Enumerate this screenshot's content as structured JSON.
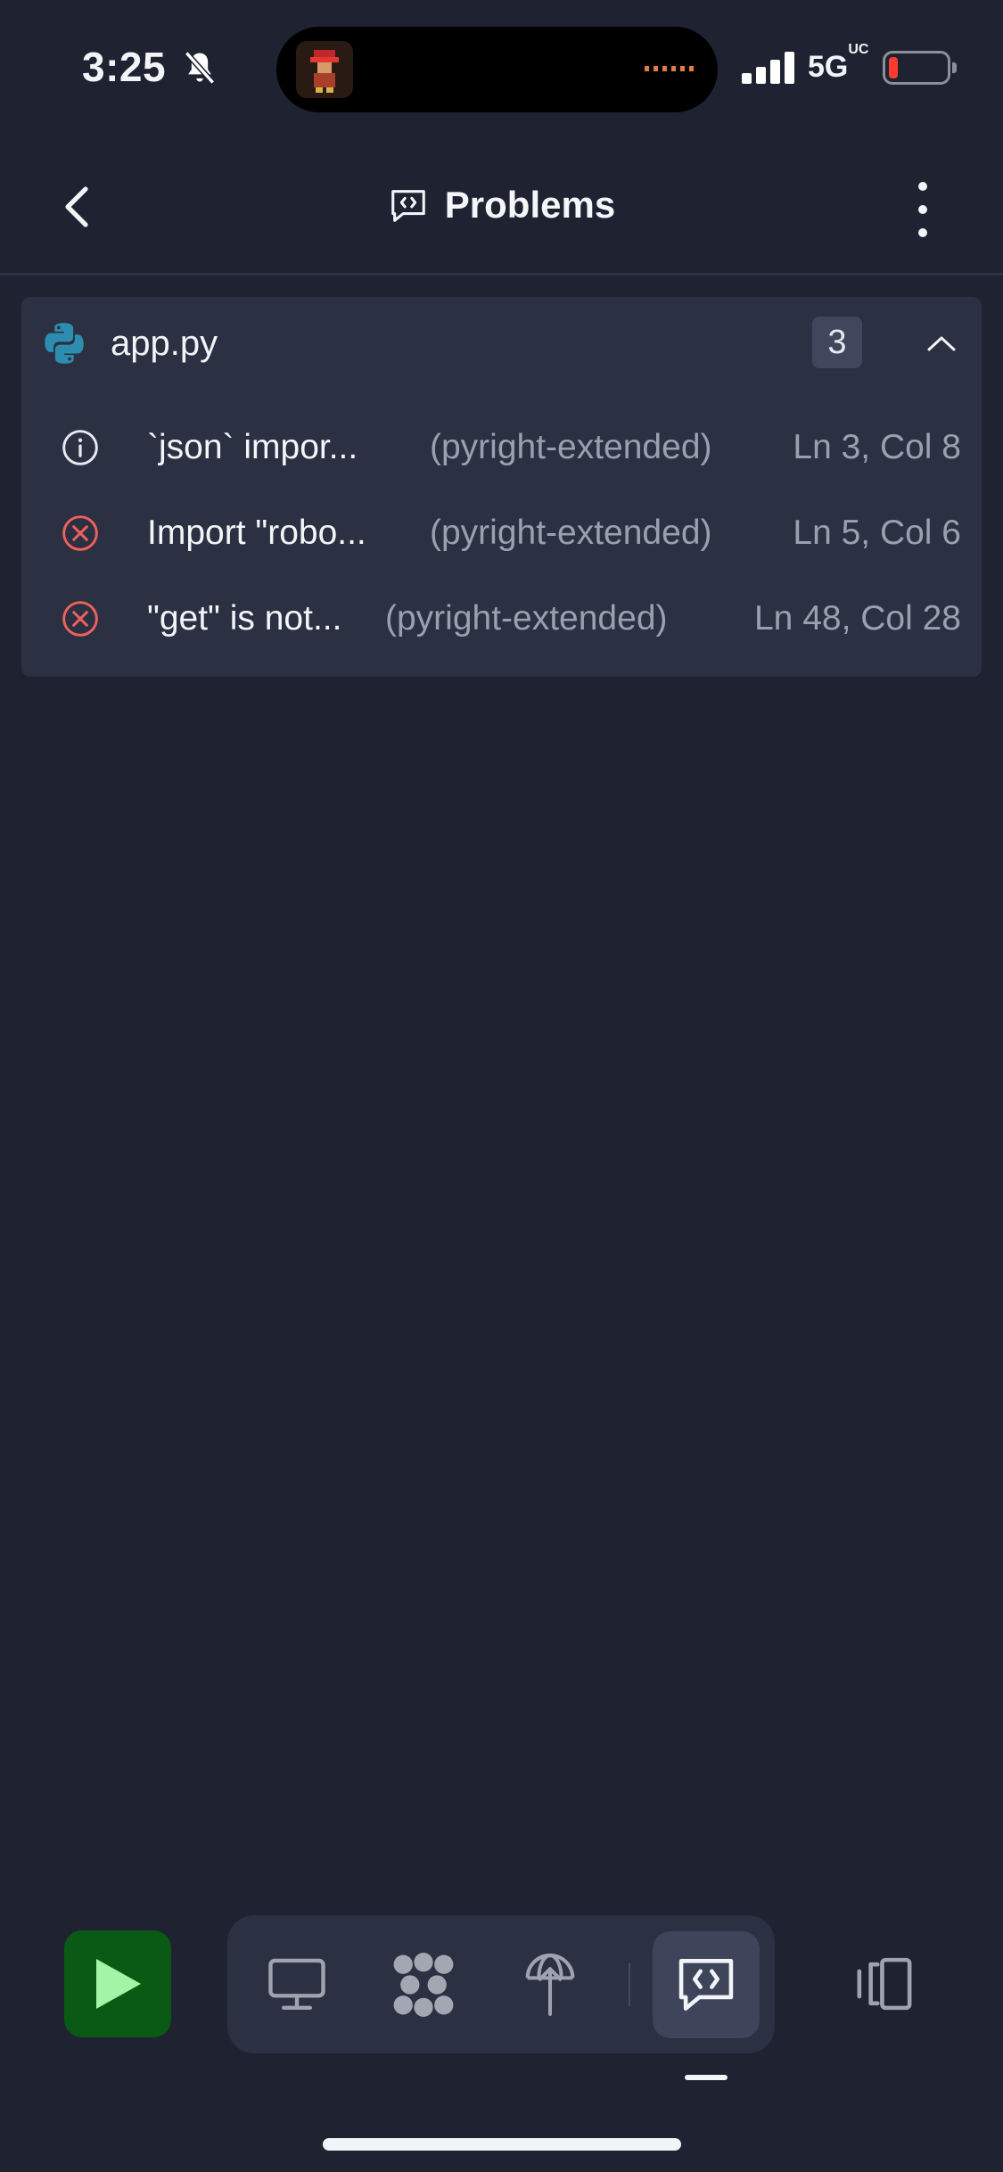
{
  "status_bar": {
    "time": "3:25",
    "network": "5G",
    "network_superscript": "UC",
    "battery_color": "#ff3b30"
  },
  "header": {
    "title": "Problems",
    "title_icon": "code-message-icon"
  },
  "file": {
    "name": "app.py",
    "icon": "python-icon",
    "problem_count": "3",
    "problems": [
      {
        "severity": "info",
        "icon": "info-icon",
        "message": "`json` impor...",
        "source": "(pyright-extended)",
        "location": "Ln 3, Col 8"
      },
      {
        "severity": "error",
        "icon": "error-icon",
        "message": "Import \"robo...",
        "source": "(pyright-extended)",
        "location": "Ln 5, Col 6"
      },
      {
        "severity": "error",
        "icon": "error-icon",
        "message": "\"get\" is not...",
        "source": "(pyright-extended)",
        "location": "Ln 48, Col 28"
      }
    ]
  },
  "toolbar": {
    "run_icon": "play-icon",
    "tools": [
      "monitor-icon",
      "workflows-icon",
      "deploy-icon",
      "problems-icon"
    ],
    "active_tool": "problems-icon",
    "layout_icon": "layout-toggle-icon"
  },
  "colors": {
    "background": "#1e2231",
    "panel": "#2b3042",
    "run_button": "#0a5a16",
    "error": "#f0605c",
    "python_blue": "#2d8db0"
  }
}
